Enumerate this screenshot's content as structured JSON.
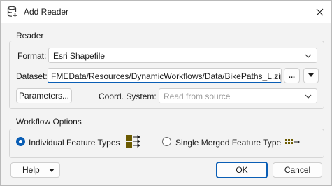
{
  "window": {
    "title": "Add Reader",
    "close_glyph": "✕"
  },
  "reader_group": {
    "label": "Reader",
    "format_label": "Format:",
    "format_value": "Esri Shapefile",
    "dataset_label": "Dataset:",
    "dataset_value": "FMEData/Resources/DynamicWorkflows/Data/BikePaths_L.zip",
    "browse_label": "...",
    "parameters_label": "Parameters...",
    "coord_label": "Coord. System:",
    "coord_placeholder": "Read from source"
  },
  "workflow_group": {
    "label": "Workflow Options",
    "option_individual": "Individual Feature Types",
    "option_merged": "Single Merged Feature Type",
    "selected": "individual"
  },
  "footer": {
    "help_label": "Help",
    "ok_label": "OK",
    "cancel_label": "Cancel"
  },
  "icons": {
    "title": "database-add-icon",
    "format_dropdown": "chevron-down-icon",
    "dataset_menu": "triangle-down-icon",
    "individual": "multiple-tables-icon",
    "merged": "single-table-icon"
  },
  "colors": {
    "accent": "#0a5eb5",
    "table_icon": "#6b5a00"
  }
}
